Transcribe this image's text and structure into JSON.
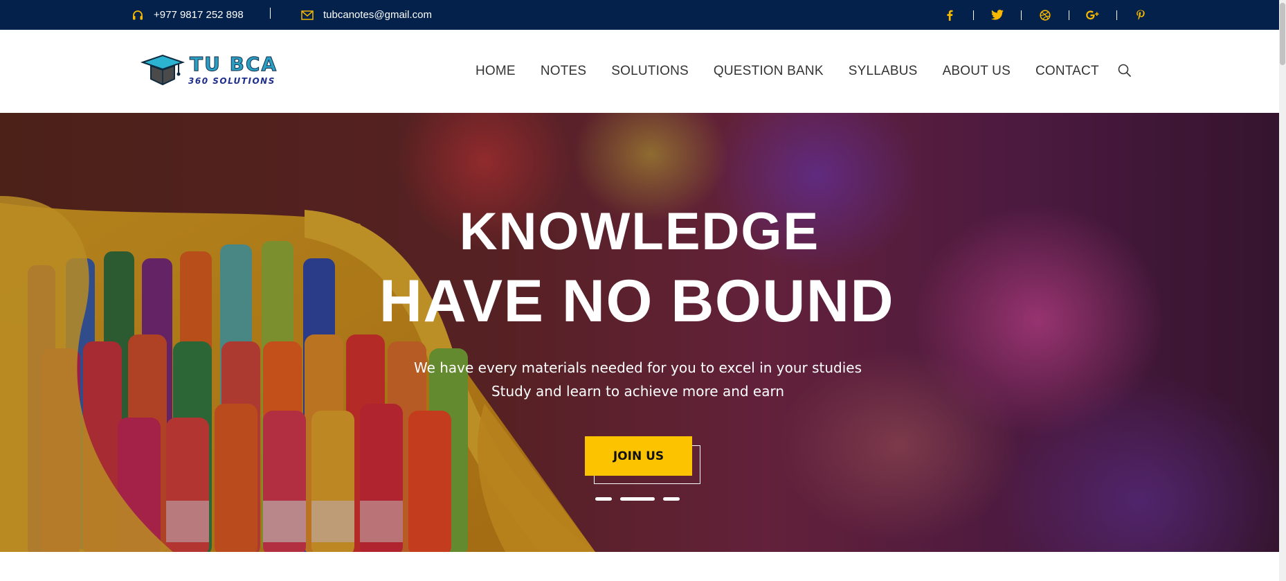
{
  "topbar": {
    "phone": "+977 9817 252 898",
    "email": "tubcanotes@gmail.com",
    "phone_icon": "headphones-icon",
    "email_icon": "envelope-icon",
    "socials": [
      {
        "name": "facebook-icon",
        "glyph": "f"
      },
      {
        "name": "twitter-icon",
        "glyph": "t"
      },
      {
        "name": "dribbble-icon",
        "glyph": "d"
      },
      {
        "name": "google-plus-icon",
        "glyph": "g+"
      },
      {
        "name": "pinterest-icon",
        "glyph": "p"
      }
    ],
    "bg_color": "#03214a",
    "icon_color": "#f6b800"
  },
  "header": {
    "logo_text_main": "TU BCA",
    "logo_text_sub": "360 SOLUTIONS",
    "nav": [
      "HOME",
      "NOTES",
      "SOLUTIONS",
      "QUESTION BANK",
      "SYLLABUS",
      "ABOUT US",
      "CONTACT"
    ],
    "search_icon": "search-icon"
  },
  "hero": {
    "title_line1": "KNOWLEDGE",
    "title_line2": "HAVE NO BOUND",
    "subtitle_line1": "We have every materials needed for you to excel in your studies",
    "subtitle_line2": "Study and learn to achieve more and earn",
    "cta_label": "JOIN US",
    "cta_color": "#fcc300",
    "slides": 3,
    "active_slide": 2
  }
}
